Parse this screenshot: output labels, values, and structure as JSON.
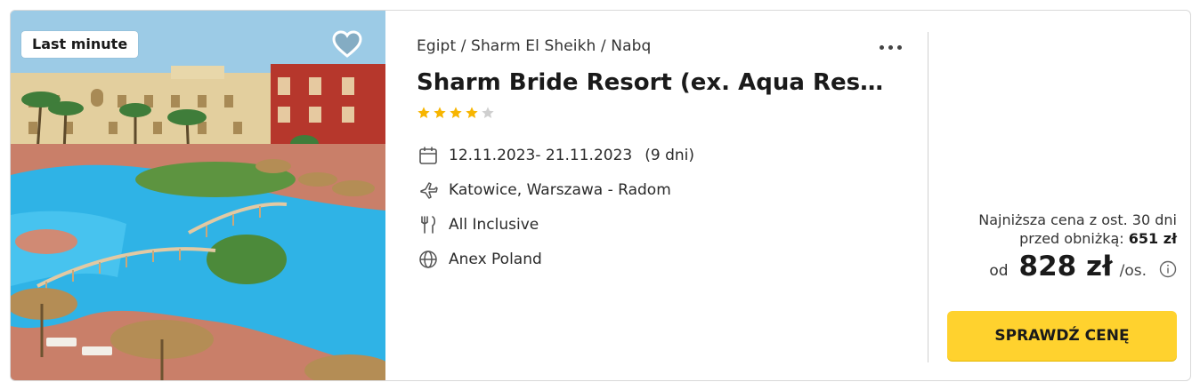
{
  "badge": "Last minute",
  "breadcrumb": "Egipt / Sharm El Sheikh / Nabq",
  "title": "Sharm Bride Resort (ex. Aqua Resort Sharm El Sheikh)",
  "rating": {
    "value": 4,
    "max": 5,
    "filled_color": "#f7b500",
    "empty_color": "#cfcfcf"
  },
  "dates": "12.11.2023- 21.11.2023",
  "duration": "(9 dni)",
  "departure": "Katowice, Warszawa - Radom",
  "board": "All Inclusive",
  "operator": "Anex Poland",
  "icons": {
    "favorite": "heart-icon",
    "more": "more-dots-icon",
    "dates": "calendar-icon",
    "departure": "plane-icon",
    "board": "fork-knife-icon",
    "operator": "globe-icon",
    "info": "info-icon"
  },
  "price": {
    "lowest_line1": "Najniższa cena z ost. 30 dni",
    "lowest_line2_prefix": "przed obniżką:",
    "lowest_value": "651 zł",
    "from_label": "od",
    "amount": "828 zł",
    "per_person": "/os."
  },
  "cta_label": "SPRAWDŹ CENĘ",
  "colors": {
    "accent": "#ffd22e",
    "text": "#1a1a1a"
  }
}
